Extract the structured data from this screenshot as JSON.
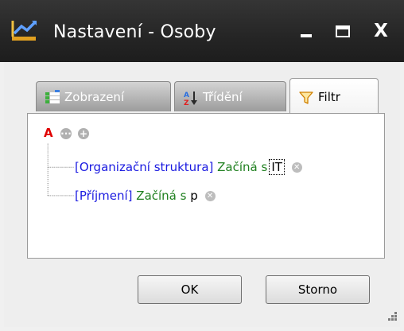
{
  "window": {
    "title": "Nastavení - Osoby",
    "controls": {
      "minimize": "_",
      "maximize": "□",
      "close": "X"
    }
  },
  "tabs": [
    {
      "label": "Zobrazení",
      "icon": "grid-view-icon",
      "active": false
    },
    {
      "label": "Třídění",
      "icon": "sort-az-icon",
      "active": false
    },
    {
      "label": "Filtr",
      "icon": "funnel-icon",
      "active": true
    }
  ],
  "filter": {
    "root_operator": "A",
    "conditions": [
      {
        "field": "[Organizační struktura]",
        "operator": "Začíná s",
        "value": "IT",
        "focused": true
      },
      {
        "field": "[Příjmení]",
        "operator": "Začíná s",
        "value": "p",
        "focused": false
      }
    ]
  },
  "buttons": {
    "ok": "OK",
    "cancel": "Storno"
  },
  "colors": {
    "title_bar": "#252525",
    "field": "#1a1ae0",
    "operator": "#208020",
    "root_operator": "#e00000"
  }
}
